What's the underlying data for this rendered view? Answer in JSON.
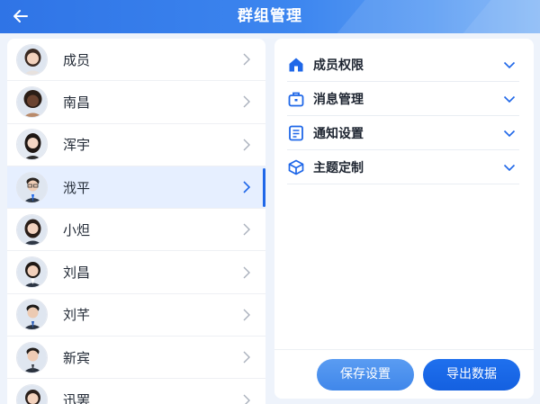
{
  "header": {
    "title": "群组管理",
    "back_icon": "arrow-left-icon"
  },
  "members": [
    {
      "name": "成员",
      "avatar": "woman-avatar-1",
      "selected": false
    },
    {
      "name": "南昌",
      "avatar": "man-curly-avatar",
      "selected": false
    },
    {
      "name": "浑宇",
      "avatar": "woman-avatar-2",
      "selected": false
    },
    {
      "name": "浌平",
      "avatar": "man-glasses-avatar",
      "selected": true
    },
    {
      "name": "小炟",
      "avatar": "woman-avatar-3",
      "selected": false
    },
    {
      "name": "刘昌",
      "avatar": "woman-avatar-4",
      "selected": false
    },
    {
      "name": "刘芊",
      "avatar": "man-avatar-1",
      "selected": false
    },
    {
      "name": "新宾",
      "avatar": "man-avatar-2",
      "selected": false
    },
    {
      "name": "迅罢",
      "avatar": "woman-avatar-5",
      "selected": false
    }
  ],
  "settings": [
    {
      "label": "成员权限",
      "icon": "home-icon"
    },
    {
      "label": "消息管理",
      "icon": "briefcase-icon"
    },
    {
      "label": "通知设置",
      "icon": "document-icon"
    },
    {
      "label": "主题定制",
      "icon": "cube-icon"
    }
  ],
  "buttons": {
    "save_label": "保存设置",
    "export_label": "导出数据"
  },
  "colors": {
    "primary": "#1f67e8",
    "header_start": "#2f74e6",
    "selected_row": "#e6efff"
  }
}
